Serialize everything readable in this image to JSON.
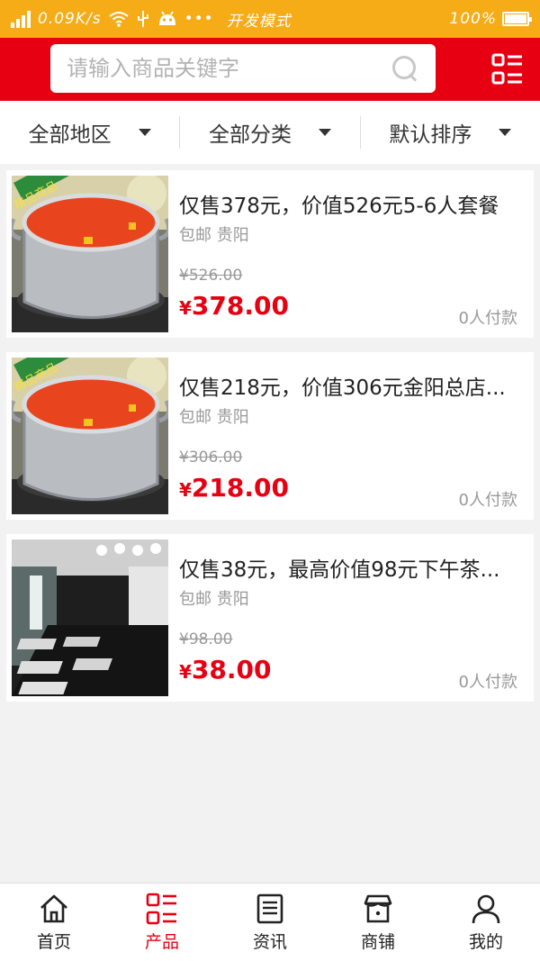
{
  "statusbar": {
    "speed": "0.09K/s",
    "mode": "开发模式",
    "battery": "100%"
  },
  "search": {
    "placeholder": "请输入商品关键字"
  },
  "filters": [
    {
      "label": "全部地区"
    },
    {
      "label": "全部分类"
    },
    {
      "label": "默认排序"
    }
  ],
  "products": [
    {
      "title": "仅售378元，价值526元5-6人套餐",
      "location": "包邮 贵阳",
      "original_price": "¥526.00",
      "price_symbol": "¥",
      "price": "378.00",
      "sold": "0人付款",
      "badge": "精品商品"
    },
    {
      "title": "仅售218元，价值306元金阳总店...",
      "location": "包邮 贵阳",
      "original_price": "¥306.00",
      "price_symbol": "¥",
      "price": "218.00",
      "sold": "0人付款",
      "badge": "精品商品"
    },
    {
      "title": "仅售38元，最高价值98元下午茶...",
      "location": "包邮 贵阳",
      "original_price": "¥98.00",
      "price_symbol": "¥",
      "price": "38.00",
      "sold": "0人付款"
    }
  ],
  "tabs": [
    {
      "label": "首页",
      "icon": "home-icon"
    },
    {
      "label": "产品",
      "icon": "product-list-icon",
      "active": true
    },
    {
      "label": "资讯",
      "icon": "news-icon"
    },
    {
      "label": "商铺",
      "icon": "store-icon"
    },
    {
      "label": "我的",
      "icon": "user-icon"
    }
  ],
  "colors": {
    "statusbar": "#f5ac17",
    "brand_red": "#e60012",
    "background": "#f2f2f2"
  }
}
